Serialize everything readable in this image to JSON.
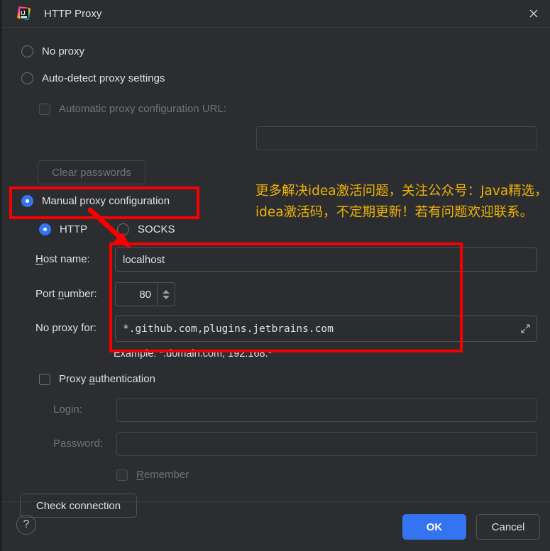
{
  "window": {
    "title": "HTTP Proxy",
    "logo_icon": "intellij-idea-logo",
    "close_icon": "close-icon"
  },
  "proxy_mode": {
    "no_proxy_label": "No proxy",
    "auto_detect_label": "Auto-detect proxy settings",
    "auto_config_url_label": "Automatic proxy configuration URL:",
    "auto_config_url_value": "",
    "clear_passwords_label": "Clear passwords",
    "manual_label": "Manual proxy configuration",
    "selected": "manual"
  },
  "protocol": {
    "http_label": "HTTP",
    "socks_label": "SOCKS",
    "selected": "HTTP"
  },
  "fields": {
    "host_label_pre": "H",
    "host_label_post": "ost name:",
    "host_value": "localhost",
    "port_label_pre": "Port ",
    "port_label_mn": "n",
    "port_label_post": "umber:",
    "port_value": "80",
    "no_proxy_label": "No proxy for:",
    "no_proxy_value": "*.github.com,plugins.jetbrains.com",
    "example_text": "Example: *.domain.com, 192.168.*",
    "expand_icon": "expand-diagonal-icon",
    "spinner_up_icon": "spinner-up-icon",
    "spinner_down_icon": "spinner-down-icon"
  },
  "auth": {
    "checkbox_label_pre": "Proxy ",
    "checkbox_label_mn": "a",
    "checkbox_label_post": "uthentication",
    "login_label": "Login:",
    "login_value": "",
    "password_label": "Password:",
    "password_value": "",
    "remember_label_pre": "R",
    "remember_label_post": "emember"
  },
  "actions": {
    "check_connection_label": "Check connection",
    "help_label": "?",
    "ok_label": "OK",
    "cancel_label": "Cancel"
  },
  "annotations": {
    "line1": "更多解决idea激活问题，关注公众号：Java精选，",
    "line2": "idea激活码，不定期更新！若有问题欢迎联系。",
    "text_color": "#efb300",
    "box_color": "#f90000"
  },
  "colors": {
    "background": "#2b2d30",
    "accent": "#3574f0",
    "text": "#dfe1e5",
    "text_dim": "#6f737a",
    "border": "#4e5157"
  }
}
